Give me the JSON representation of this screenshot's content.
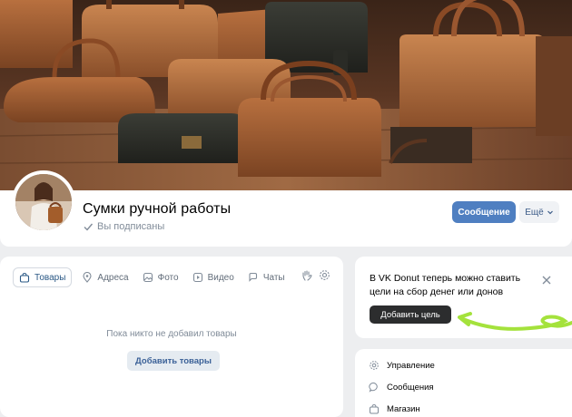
{
  "group": {
    "title": "Сумки ручной работы",
    "subscribed_label": "Вы подписаны"
  },
  "actions": {
    "message_label": "Сообщение",
    "more_label": "Ещё"
  },
  "tabs": [
    {
      "label": "Товары",
      "icon": "bag-icon",
      "active": true
    },
    {
      "label": "Адреса",
      "icon": "location-pin-icon",
      "active": false
    },
    {
      "label": "Фото",
      "icon": "photo-icon",
      "active": false
    },
    {
      "label": "Видео",
      "icon": "video-icon",
      "active": false
    },
    {
      "label": "Чаты",
      "icon": "chat-icon",
      "active": false
    }
  ],
  "tab_tools": [
    "hand-wave-icon",
    "gear-icon"
  ],
  "goods": {
    "empty_text": "Пока никто не добавил товары",
    "add_label": "Добавить товары"
  },
  "donut": {
    "text": "В VK Donut теперь можно ставить цели на сбор денег или донов",
    "add_goal_label": "Добавить цель",
    "accent_arrow_color": "#a4e23c"
  },
  "side_menu": [
    {
      "label": "Управление",
      "icon": "gear-icon"
    },
    {
      "label": "Сообщения",
      "icon": "chat-bubble-icon"
    },
    {
      "label": "Магазин",
      "icon": "shop-bag-icon"
    }
  ],
  "colors": {
    "primary_button": "#4f7fc1",
    "page_background": "#edeef0",
    "link": "#2a5885"
  }
}
